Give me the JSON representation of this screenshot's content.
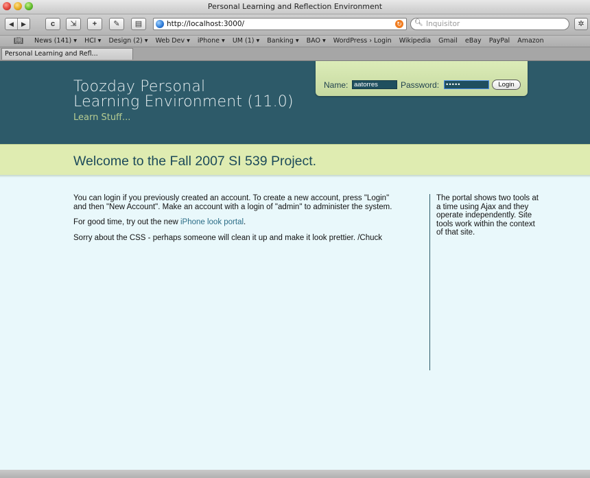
{
  "window": {
    "title": "Personal Learning and Reflection Environment"
  },
  "toolbar": {
    "back_icon": "back-arrow-icon",
    "forward_icon": "forward-arrow-icon",
    "reload_glyph": "c",
    "snapback_icon": "snapback-icon",
    "add_glyph": "+",
    "edit_icon": "edit-icon",
    "print_icon": "print-icon",
    "url": "http://localhost:3000/",
    "search_placeholder": "Inquisitor"
  },
  "bookmarks": {
    "items": [
      "News (141) ▾",
      "HCI ▾",
      "Design (2) ▾",
      "Web Dev ▾",
      "iPhone ▾",
      "UM (1) ▾",
      "Banking ▾",
      "BAO ▾",
      "WordPress › Login",
      "Wikipedia",
      "Gmail",
      "eBay",
      "PayPal",
      "Amazon"
    ]
  },
  "tabs": [
    {
      "label": "Personal Learning and Refl..."
    }
  ],
  "header": {
    "title_line1": "Toozday Personal",
    "title_line2": "Learning Environment (11.0)",
    "tagline": "Learn Stuff..."
  },
  "login": {
    "name_label": "Name:",
    "name_value": "aatorres",
    "password_label": "Password:",
    "password_value": "•••••",
    "button_label": "Login"
  },
  "welcome": {
    "heading": "Welcome to the Fall 2007 SI 539 Project."
  },
  "main": {
    "para1": "You can login if you previously created an account. To create a new account, press \"Login\" and then \"New Account\". Make an account with a login of \"admin\" to administer the system.",
    "para2_prefix": "For good time, try out the new ",
    "para2_link": "iPhone look portal",
    "para2_suffix": ".",
    "para3": "Sorry about the CSS - perhaps someone will clean it up and make it look prettier. /Chuck"
  },
  "sidebar": {
    "text": "The portal shows two tools at a time using Ajax and they operate independently. Site tools work within the context of that site."
  },
  "colors": {
    "header_bg": "#2d5a69",
    "welcome_bg": "#dfecb1",
    "page_bg": "#e9f8fb",
    "link": "#2b6c86"
  }
}
